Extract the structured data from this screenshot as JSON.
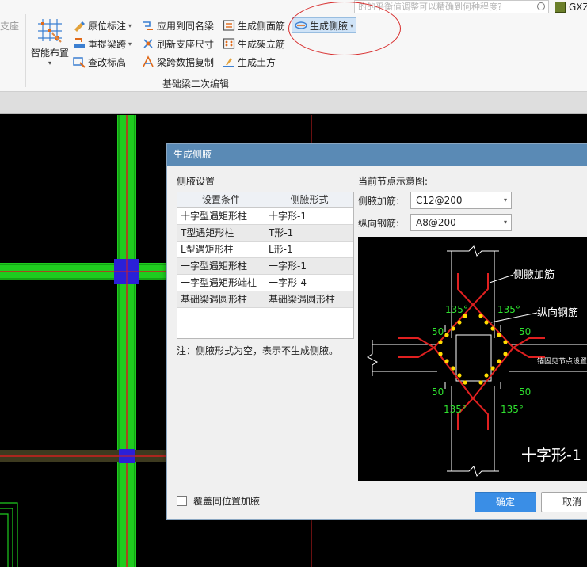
{
  "ribbon": {
    "left_clipped_label": "支座",
    "big_button": {
      "label": "智能布置"
    },
    "col1": [
      {
        "label": "原位标注",
        "has_dropdown": true,
        "icon": "in-place-annotation-icon"
      },
      {
        "label": "重提梁跨",
        "has_dropdown": true,
        "icon": "respan-icon"
      },
      {
        "label": "查改标高",
        "has_dropdown": false,
        "icon": "elevation-icon"
      }
    ],
    "col2": [
      {
        "label": "应用到同名梁",
        "icon": "apply-same-name-icon"
      },
      {
        "label": "刷新支座尺寸",
        "icon": "refresh-support-icon"
      },
      {
        "label": "梁跨数据复制",
        "icon": "copy-span-icon"
      }
    ],
    "col3": [
      {
        "label": "生成侧面筋",
        "icon": "side-rebar-icon"
      },
      {
        "label": "生成架立筋",
        "icon": "erection-rebar-icon"
      },
      {
        "label": "生成土方",
        "icon": "earthwork-icon"
      }
    ],
    "active_button": {
      "label": "生成侧腋",
      "icon": "side-haunch-icon"
    },
    "group_label": "基础梁二次编辑",
    "search_placeholder": "的的平衡值调整可以精确到何种程度?",
    "user_label": "GXZ"
  },
  "colors": {
    "dialog_title": "#5a8ab5",
    "ok_button": "#3a8ee6",
    "beam_green": "#1fcc1f",
    "beam_red_line": "#d21f1f",
    "column_blue": "#2a20d8"
  },
  "dialog": {
    "title": "生成侧腋",
    "settings_label": "侧腋设置",
    "table": {
      "headers": [
        "设置条件",
        "侧腋形式"
      ],
      "rows": [
        [
          "十字型遇矩形柱",
          "十字形-1"
        ],
        [
          "T型遇矩形柱",
          "T形-1"
        ],
        [
          "L型遇矩形柱",
          "L形-1"
        ],
        [
          "一字型遇矩形柱",
          "一字形-1"
        ],
        [
          "一字型遇矩形端柱",
          "一字形-4"
        ],
        [
          "基础梁遇圆形柱",
          "基础梁遇圆形柱"
        ]
      ]
    },
    "note": "注：侧腋形式为空，表示不生成侧腋。",
    "preview_label": "当前节点示意图:",
    "haunch_rebar_label": "侧腋加筋:",
    "haunch_rebar_value": "C12@200",
    "long_rebar_label": "纵向钢筋:",
    "long_rebar_value": "A8@200",
    "diagram": {
      "label_haunch": "侧腋加筋",
      "label_long": "纵向钢筋",
      "angle_135": "135°",
      "dim_50": "50",
      "anchor_note": "锚固见节点设置",
      "shape_name": "十字形-1"
    },
    "override_label": "覆盖同位置加腋",
    "ok_label": "确定",
    "cancel_label": "取消"
  }
}
